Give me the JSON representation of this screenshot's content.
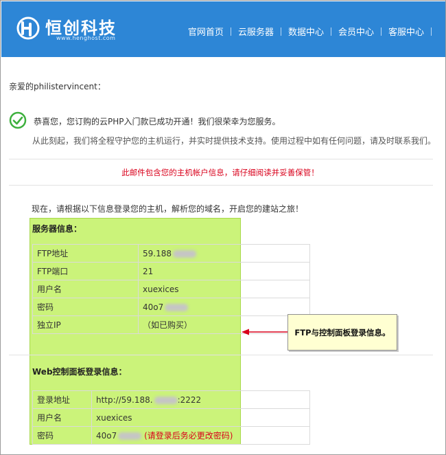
{
  "header": {
    "logo_text": "恒创科技",
    "logo_url": "www.henghost.com",
    "nav": [
      "官网首页",
      "云服务器",
      "数据中心",
      "会员中心",
      "客服中心"
    ],
    "bg_color": "#2d86d6"
  },
  "email": {
    "greeting": "亲爱的philistervincent：",
    "congrats": "恭喜您，您订购的云PHP入门款已成功开通！我们很荣幸为您服务。",
    "subtext": "从此刻起，我们将全程守护您的主机运行，并实时提供技术支持。使用过程中如有任何问题，请及时联系我们。",
    "warning": "此邮件包含您的主机帐户信息，请仔细阅读并妥善保管！",
    "intro": "现在，请根据以下信息登录您的主机，解析您的域名，开启您的建站之旅！"
  },
  "server_section": {
    "title": "服务器信息：",
    "rows": [
      {
        "label": "FTP地址",
        "value": "59.188"
      },
      {
        "label": "FTP端口",
        "value": "21"
      },
      {
        "label": "用户名",
        "value": "xuexices"
      },
      {
        "label": "密码",
        "value": "40o7"
      },
      {
        "label": "独立IP",
        "value": "（如已购买）"
      }
    ]
  },
  "web_section": {
    "title": "Web控制面板登录信息：",
    "rows": [
      {
        "label": "登录地址",
        "value": "http://59.188.",
        "suffix": ":2222"
      },
      {
        "label": "用户名",
        "value": "xuexices"
      },
      {
        "label": "密码",
        "value": "40o7",
        "note": "(请登录后务必更改密码)"
      }
    ]
  },
  "annotation": {
    "callout": "FTP与控制面板登录信息。",
    "highlight_color": "#cbf37a",
    "arrow_color": "#d9001b"
  }
}
